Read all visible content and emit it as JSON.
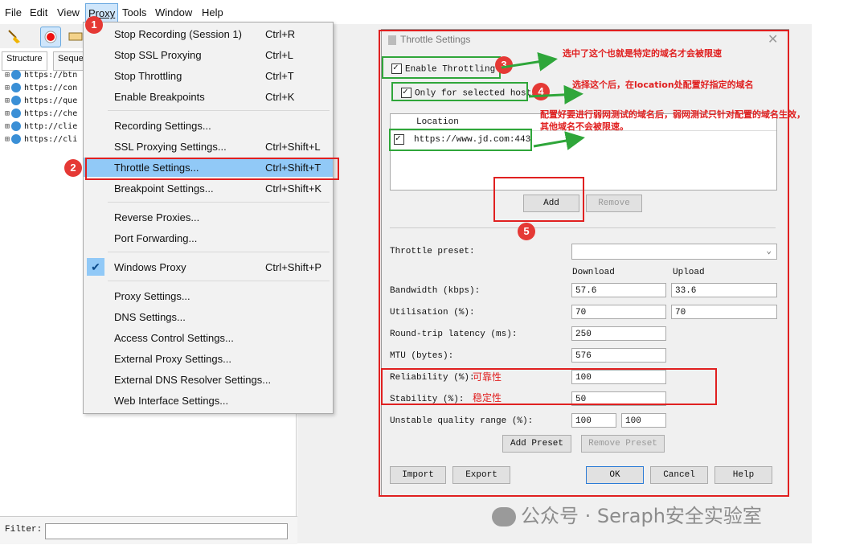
{
  "menubar": {
    "items": [
      "File",
      "Edit",
      "View",
      "Proxy",
      "Tools",
      "Window",
      "Help"
    ]
  },
  "left": {
    "tabs": [
      "Structure",
      "Sequen"
    ],
    "rows": [
      "https://btn",
      "https://con",
      "https://que",
      "https://che",
      "http://clie",
      "https://cli"
    ],
    "filter_label": "Filter:"
  },
  "proxy_menu": {
    "items": [
      {
        "label": "Stop Recording (Session 1)",
        "shortcut": "Ctrl+R"
      },
      {
        "label": "Stop SSL Proxying",
        "shortcut": "Ctrl+L"
      },
      {
        "label": "Stop Throttling",
        "shortcut": "Ctrl+T"
      },
      {
        "label": "Enable Breakpoints",
        "shortcut": "Ctrl+K"
      },
      {
        "label": "Recording Settings...",
        "shortcut": ""
      },
      {
        "label": "SSL Proxying Settings...",
        "shortcut": "Ctrl+Shift+L"
      },
      {
        "label": "Throttle Settings...",
        "shortcut": "Ctrl+Shift+T"
      },
      {
        "label": "Breakpoint Settings...",
        "shortcut": "Ctrl+Shift+K"
      },
      {
        "label": "Reverse Proxies...",
        "shortcut": ""
      },
      {
        "label": "Port Forwarding...",
        "shortcut": ""
      },
      {
        "label": "Windows Proxy",
        "shortcut": "Ctrl+Shift+P"
      },
      {
        "label": "Proxy Settings...",
        "shortcut": ""
      },
      {
        "label": "DNS Settings...",
        "shortcut": ""
      },
      {
        "label": "Access Control Settings...",
        "shortcut": ""
      },
      {
        "label": "External Proxy Settings...",
        "shortcut": ""
      },
      {
        "label": "External DNS Resolver Settings...",
        "shortcut": ""
      },
      {
        "label": "Web Interface Settings...",
        "shortcut": ""
      }
    ]
  },
  "dialog": {
    "title": "Throttle Settings",
    "enable_throttling": "Enable Throttling",
    "only_selected_hosts": "Only for selected hosts",
    "location_header": "Location",
    "location_value": "https://www.jd.com:443",
    "add": "Add",
    "remove": "Remove",
    "preset_label": "Throttle preset:",
    "download": "Download",
    "upload": "Upload",
    "bandwidth_label": "Bandwidth (kbps):",
    "bandwidth_down": "57.6",
    "bandwidth_up": "33.6",
    "utilisation_label": "Utilisation (%):",
    "utilisation_down": "70",
    "utilisation_up": "70",
    "latency_label": "Round-trip latency (ms):",
    "latency": "250",
    "mtu_label": "MTU (bytes):",
    "mtu": "576",
    "reliability_label": "Reliability (%):",
    "reliability": "100",
    "stability_label": "Stability (%):",
    "stability": "50",
    "unstable_label": "Unstable quality range (%):",
    "unstable_low": "100",
    "unstable_high": "100",
    "add_preset": "Add Preset",
    "remove_preset": "Remove Preset",
    "import": "Import",
    "export": "Export",
    "ok": "OK",
    "cancel": "Cancel",
    "help": "Help"
  },
  "annotations": {
    "badges": [
      "1",
      "2",
      "3",
      "4",
      "5"
    ],
    "note3": "选中了这个也就是特定的域名才会被限速",
    "note4": "选择这个后，在location处配置好指定的域名",
    "note5a": "配置好要进行弱网测试的域名后，弱网测试只针对配置的域名生效，",
    "note5b": "其他域名不会被限速。",
    "reliability_cn": "可靠性",
    "stability_cn": "稳定性"
  },
  "watermark": "公众号 · Seraph安全实验室",
  "colors": {
    "highlight": "#91c9f7",
    "annotation_red": "#e02020",
    "annotation_green": "#2fa63a"
  }
}
